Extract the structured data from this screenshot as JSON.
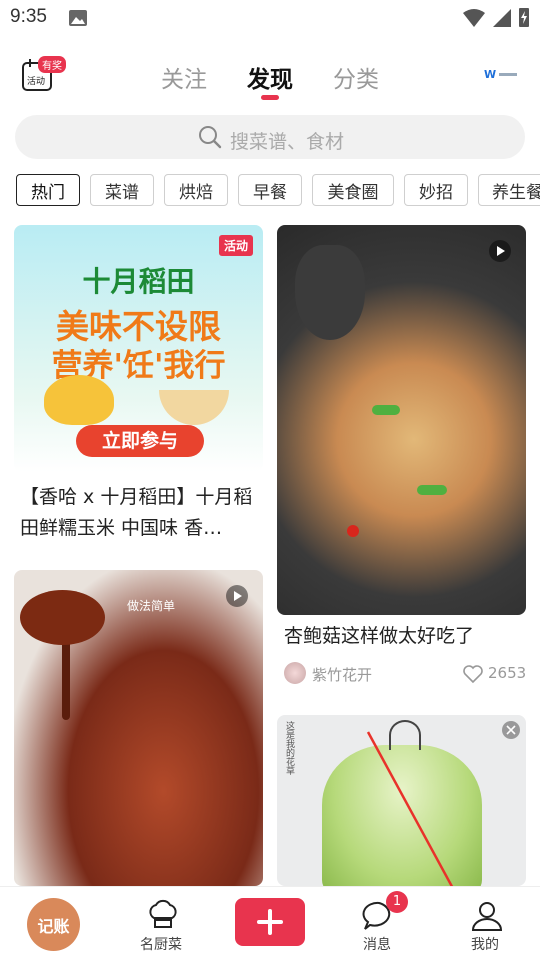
{
  "status": {
    "time": "9:35"
  },
  "header": {
    "badge": "有奖",
    "activity_icon_text": "活动",
    "tabs": [
      {
        "label": "关注"
      },
      {
        "label": "发现"
      },
      {
        "label": "分类"
      }
    ],
    "logo_text": "W"
  },
  "search": {
    "placeholder": "搜菜谱、食材"
  },
  "chips": [
    {
      "label": "热门"
    },
    {
      "label": "菜谱"
    },
    {
      "label": "烘焙"
    },
    {
      "label": "早餐"
    },
    {
      "label": "美食圈"
    },
    {
      "label": "妙招"
    },
    {
      "label": "养生餐"
    }
  ],
  "cards": {
    "promo": {
      "badge": "活动",
      "brand": "十月稻田",
      "line1": "美味不设限",
      "line2": "营养'饪'我行",
      "cta": "立即参与",
      "title": "【香哈 x 十月稻田】十月稻田鲜糯玉米 中国味 香…"
    },
    "recipe": {
      "title": "杏鲍菇这样做太好吃了",
      "author": "紫竹花开",
      "likes": "2653"
    },
    "pork": {
      "overlay": "做法简单"
    },
    "cabbage": {
      "overlay": "这是我的花草"
    }
  },
  "bottom_nav": {
    "record": "记账",
    "items": [
      {
        "label": "名厨菜"
      },
      {
        "label": ""
      },
      {
        "label": "消息"
      },
      {
        "label": "我的"
      }
    ],
    "message_badge": "1"
  },
  "colors": {
    "accent": "#e8344e",
    "record_btn": "#d9895a"
  }
}
